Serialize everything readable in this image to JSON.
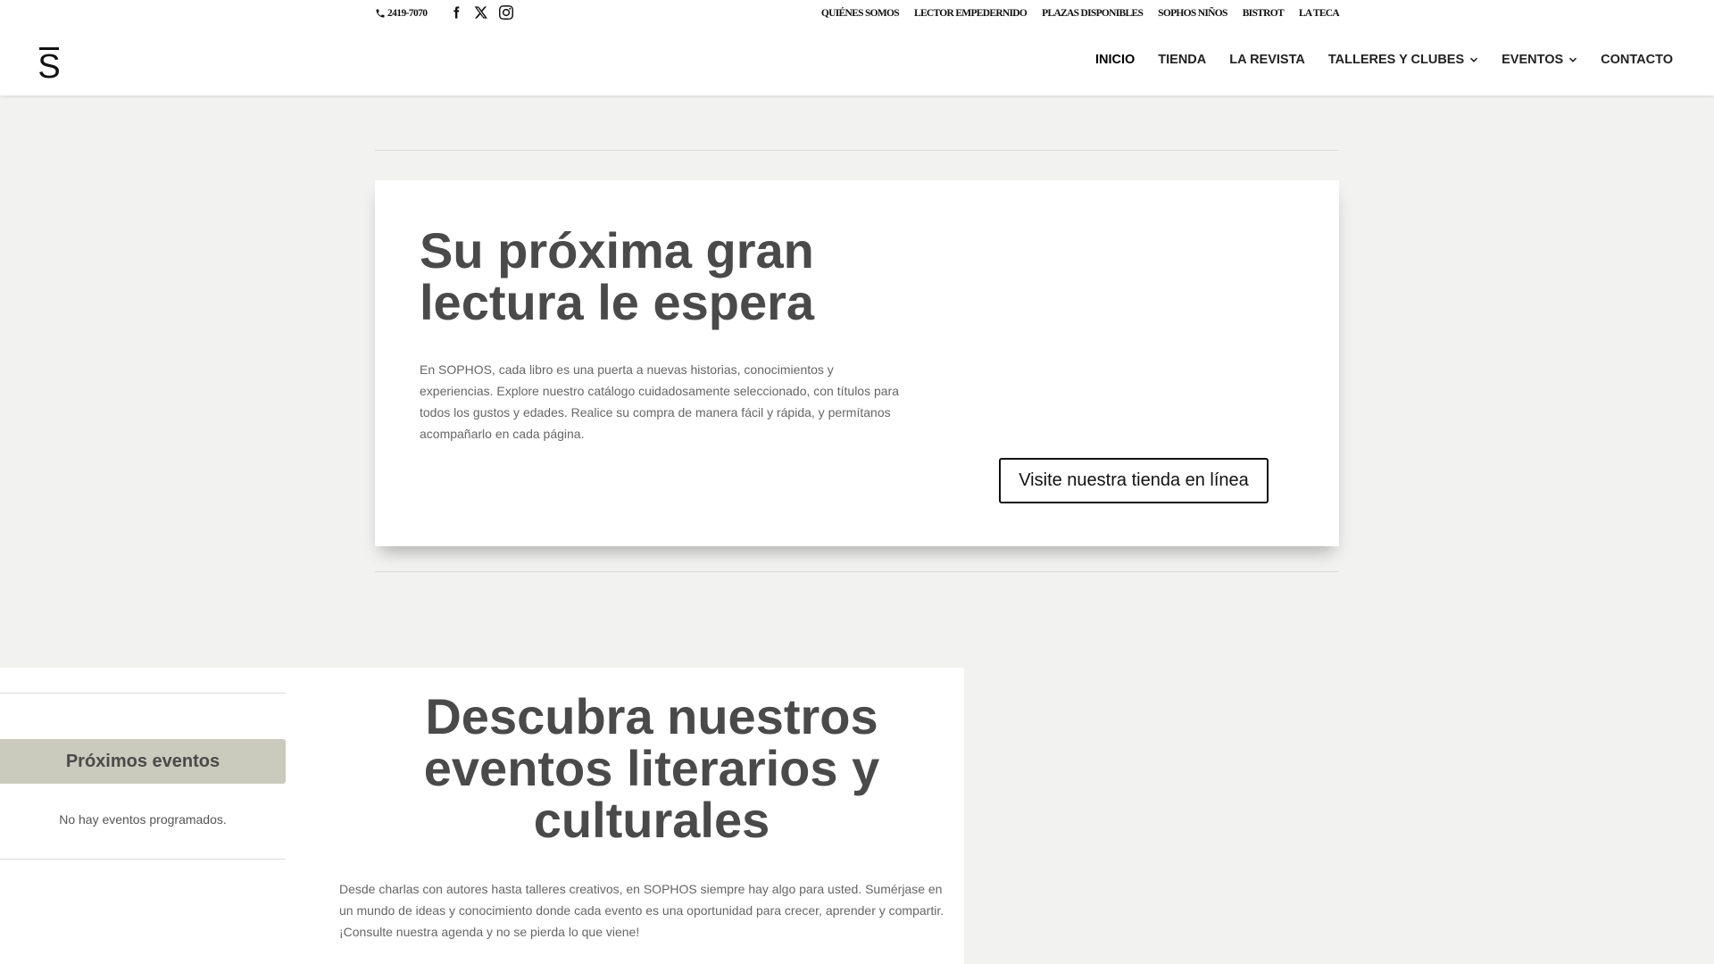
{
  "topbar": {
    "phone": "2419-7070",
    "social": [
      {
        "icon": "facebook-icon"
      },
      {
        "icon": "x-twitter-icon"
      },
      {
        "icon": "instagram-icon"
      }
    ],
    "secondary_nav": [
      "QUIÉNES SOMOS",
      "LECTOR EMPEDERNIDO",
      "PLAZAS DISPONIBLES",
      "SOPHOS NIÑOS",
      "BISTROT",
      "LA TECA"
    ]
  },
  "header": {
    "logo_letter": "S",
    "nav": [
      {
        "label": "INICIO",
        "dropdown": false,
        "active": true
      },
      {
        "label": "TIENDA",
        "dropdown": false,
        "active": false
      },
      {
        "label": "LA REVISTA",
        "dropdown": false,
        "active": false
      },
      {
        "label": "TALLERES Y CLUBES",
        "dropdown": true,
        "active": false
      },
      {
        "label": "EVENTOS",
        "dropdown": true,
        "active": false
      },
      {
        "label": "CONTACTO",
        "dropdown": false,
        "active": false
      }
    ]
  },
  "hero": {
    "title": "Su próxima gran lectura le espera",
    "text": "En SOPHOS, cada libro es una puerta a nuevas historias, conocimientos y experiencias. Explore nuestro catálogo cuidadosamente seleccionado, con títulos para todos los gustos y edades. Realice su compra de manera fácil y rápida, y permítanos acompañarlo en cada página.",
    "button": "Visite nuestra tienda en línea"
  },
  "events": {
    "sidebar_title": "Próximos eventos",
    "sidebar_empty": "No hay eventos programados.",
    "title": "Descubra nuestros eventos literarios y culturales",
    "text": "Desde charlas con autores hasta talleres creativos, en SOPHOS siempre hay algo para usted. Sumérjase en un mundo de ideas y conocimiento donde cada evento es una oportunidad para crecer, aprender y compartir. ¡Consulte nuestra agenda y no se pierda lo que viene!"
  },
  "colors": {
    "page_bg": "#f2f2f1",
    "heading": "#4a4a4a",
    "sidebar_title_bg": "#cacabd"
  }
}
